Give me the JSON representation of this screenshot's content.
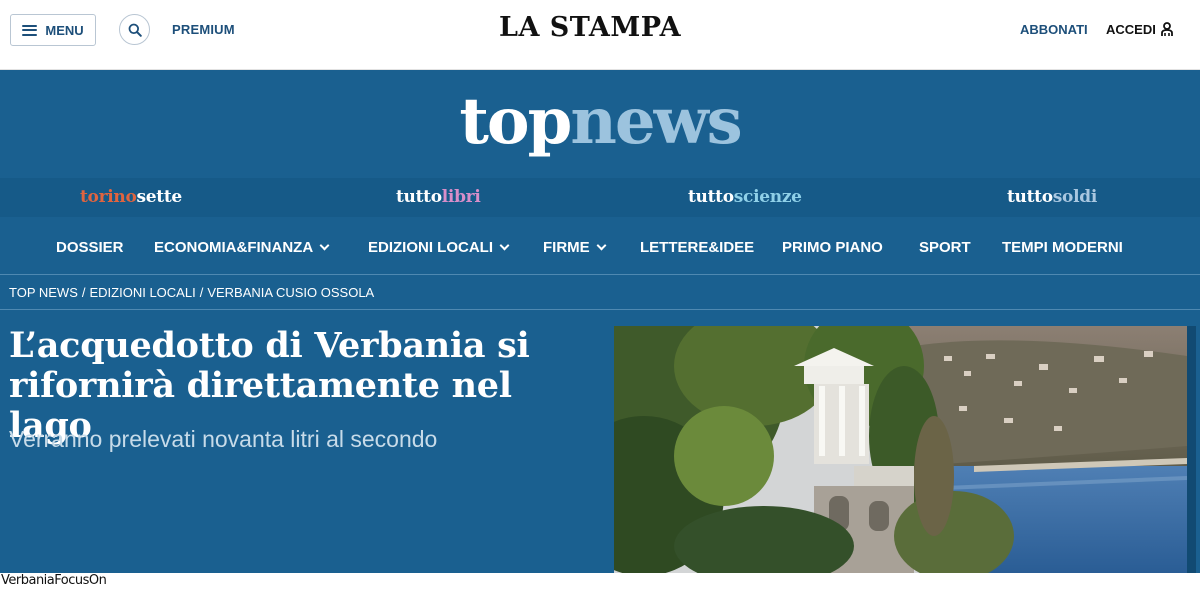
{
  "header": {
    "menu_label": "MENU",
    "premium_label": "PREMIUM",
    "brand": "LA STAMPA",
    "abbonati_label": "ABBONATI",
    "accedi_label": "ACCEDI"
  },
  "section": {
    "logo_top": "top",
    "logo_news": "news"
  },
  "partners": [
    {
      "a": "torino",
      "b": "sette"
    },
    {
      "a": "tutto",
      "b": "libri"
    },
    {
      "a": "tutto",
      "b": "scienze"
    },
    {
      "a": "tutto",
      "b": "soldi"
    }
  ],
  "nav": [
    {
      "label": "DOSSIER",
      "dropdown": false
    },
    {
      "label": "ECONOMIA&FINANZA",
      "dropdown": true
    },
    {
      "label": "EDIZIONI LOCALI",
      "dropdown": true
    },
    {
      "label": "FIRME",
      "dropdown": true
    },
    {
      "label": "LETTERE&IDEE",
      "dropdown": false
    },
    {
      "label": "PRIMO PIANO",
      "dropdown": false
    },
    {
      "label": "SPORT",
      "dropdown": false
    },
    {
      "label": "TEMPI MODERNI",
      "dropdown": false
    }
  ],
  "breadcrumb": {
    "items": [
      "TOP NEWS",
      "EDIZIONI LOCALI",
      "VERBANIA CUSIO OSSOLA"
    ],
    "separator": "/"
  },
  "article": {
    "headline_line1": "L’acquedotto di Verbania si",
    "headline_line2": "rifornirà direttamente nel lago",
    "subheadline": "Verranno prelevati novanta litri al secondo",
    "photo_credit": "VerbaniaFocusOn"
  },
  "colors": {
    "section_blue": "#1a6090",
    "partner_bar": "#165a88",
    "link_blue": "#1d4f7a",
    "torino_accent": "#e0643f",
    "libri_accent": "#d88ec9",
    "scienze_accent": "#8fd0e8",
    "soldi_accent": "#a9c7e0",
    "logo_news": "#9cc3de"
  },
  "icons": {
    "menu": "hamburger-icon",
    "search": "search-icon",
    "account": "user-icon",
    "dropdown": "chevron-down-icon"
  }
}
